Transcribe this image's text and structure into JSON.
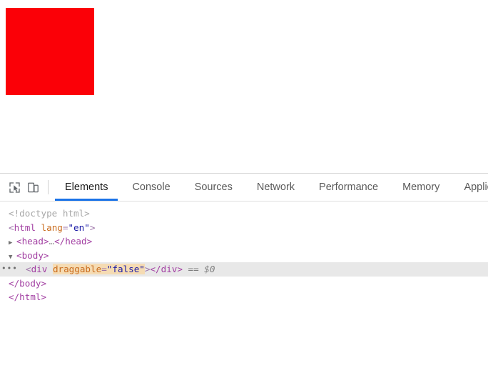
{
  "page": {
    "red_box": {
      "name": "red-square",
      "color": "#fb0007",
      "width": "124",
      "height": "122"
    }
  },
  "devtools": {
    "toolbar": {
      "icons": [
        {
          "name": "inspect-element-icon",
          "title": "Inspect element"
        },
        {
          "name": "device-toolbar-icon",
          "title": "Toggle device toolbar"
        }
      ],
      "tabs": [
        {
          "label": "Elements",
          "active": true
        },
        {
          "label": "Console",
          "active": false
        },
        {
          "label": "Sources",
          "active": false
        },
        {
          "label": "Network",
          "active": false
        },
        {
          "label": "Performance",
          "active": false
        },
        {
          "label": "Memory",
          "active": false
        },
        {
          "label": "Applica",
          "active": false
        }
      ],
      "active_tab": "Elements",
      "accent_color": "#1a73e8"
    },
    "dom_tree": {
      "doctype": "<!doctype html>",
      "html_open_lt": "<",
      "html_tag": "html",
      "html_attr_name": "lang",
      "html_attr_eq": "=",
      "html_attr_value": "\"en\"",
      "html_open_gt": ">",
      "head_twisty": "▶",
      "head_open": "<head>",
      "head_collapsed": "…",
      "head_close": "</head>",
      "body_twisty": "▼",
      "body_open": "<body>",
      "selected_row": {
        "ellipsis": "•••",
        "lt": "<",
        "tag": "div",
        "attr_name": "draggable",
        "attr_eq": "=",
        "attr_value": "\"false\"",
        "gt": ">",
        "close_tag": "</div>",
        "selected_marker": "== $0",
        "highlight_color": "#e8e8e8",
        "attr_highlight_color": "#f5dbb3"
      },
      "body_close": "</body>",
      "html_close": "</html>"
    }
  }
}
